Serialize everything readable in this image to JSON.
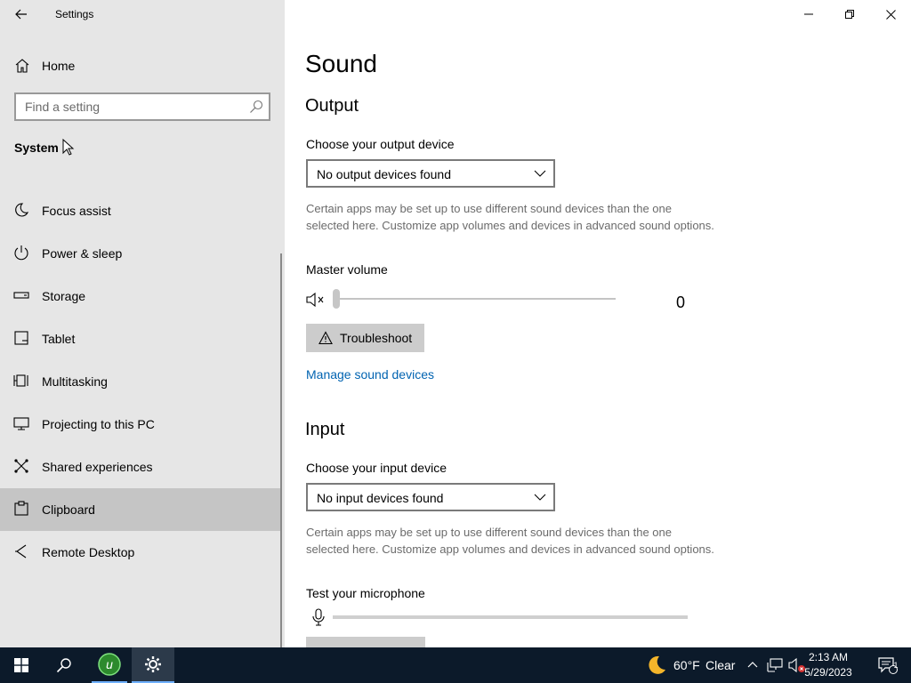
{
  "window": {
    "title": "Settings"
  },
  "sidebar": {
    "home_label": "Home",
    "search_placeholder": "Find a setting",
    "section_title": "System",
    "items": [
      {
        "label": "Focus assist",
        "icon": "moon-icon"
      },
      {
        "label": "Power & sleep",
        "icon": "power-icon"
      },
      {
        "label": "Storage",
        "icon": "storage-icon"
      },
      {
        "label": "Tablet",
        "icon": "tablet-icon"
      },
      {
        "label": "Multitasking",
        "icon": "multitasking-icon"
      },
      {
        "label": "Projecting to this PC",
        "icon": "projecting-icon"
      },
      {
        "label": "Shared experiences",
        "icon": "shared-experiences-icon"
      },
      {
        "label": "Clipboard",
        "icon": "clipboard-icon",
        "active": true
      },
      {
        "label": "Remote Desktop",
        "icon": "remote-desktop-icon"
      }
    ]
  },
  "main": {
    "page_title": "Sound",
    "output": {
      "heading": "Output",
      "choose_label": "Choose your output device",
      "device_value": "No output devices found",
      "description": "Certain apps may be set up to use different sound devices than the one selected here. Customize app volumes and devices in advanced sound options.",
      "master_volume_label": "Master volume",
      "volume_value": "0",
      "volume_level": 0,
      "troubleshoot_label": "Troubleshoot",
      "manage_link": "Manage sound devices"
    },
    "input": {
      "heading": "Input",
      "choose_label": "Choose your input device",
      "device_value": "No input devices found",
      "description": "Certain apps may be set up to use different sound devices than the one selected here. Customize app volumes and devices in advanced sound options.",
      "test_label": "Test your microphone",
      "mic_level": 0
    }
  },
  "taskbar": {
    "weather_temp": "60°F",
    "weather_condition": "Clear",
    "time": "2:13 AM",
    "date": "5/29/2023",
    "notification_count": "1"
  },
  "colors": {
    "sidebar_bg": "#e6e6e6",
    "active_item": "#c5c5c5",
    "link": "#0063b1",
    "taskbar": "#0c1a2a",
    "button": "#cccccc"
  }
}
